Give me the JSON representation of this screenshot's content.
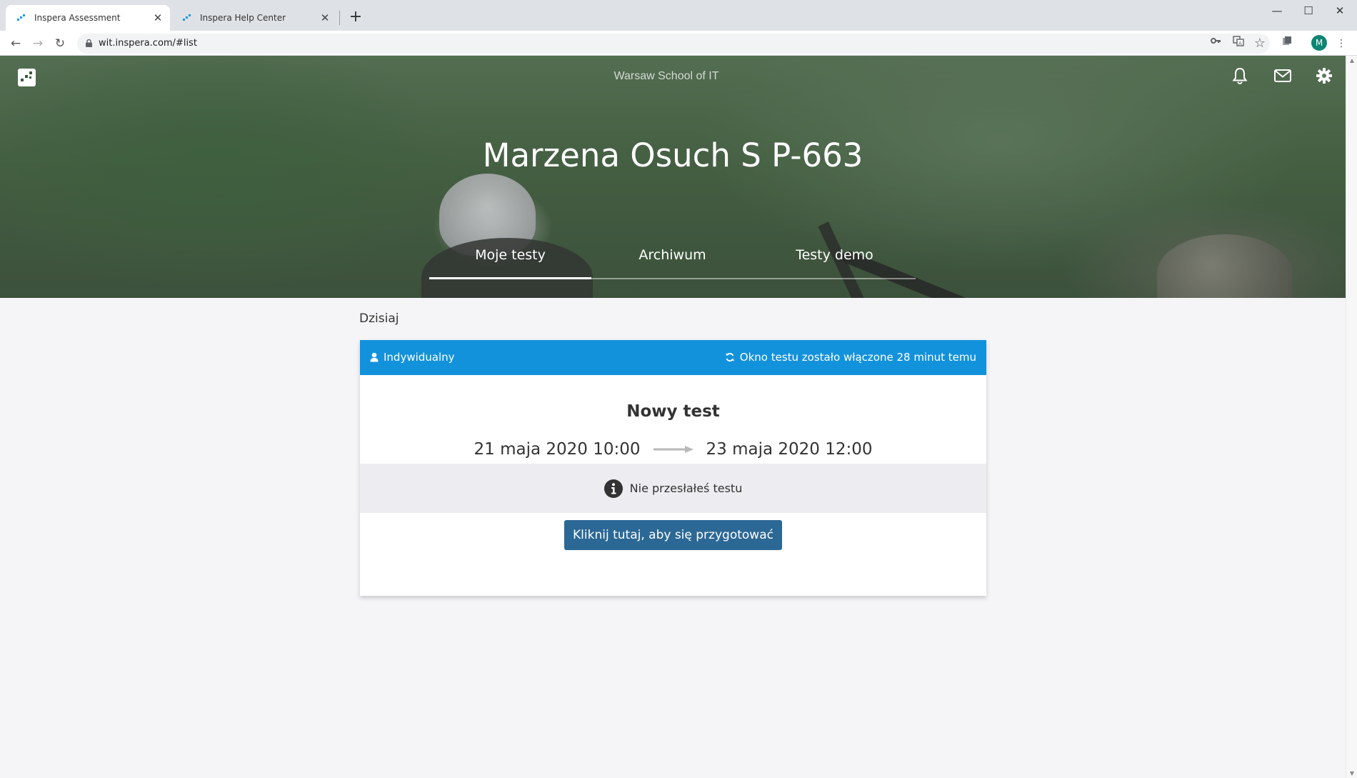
{
  "browser": {
    "tabs": [
      {
        "title": "Inspera Assessment",
        "active": true
      },
      {
        "title": "Inspera Help Center",
        "active": false
      }
    ],
    "url": "wit.inspera.com/#list",
    "profile_initial": "M"
  },
  "header": {
    "school": "Warsaw School of IT",
    "student_name": "Marzena Osuch S P-663",
    "tabs": [
      "Moje testy",
      "Archiwum",
      "Testy demo"
    ],
    "active_tab": "Moje testy"
  },
  "main": {
    "section_label": "Dzisiaj",
    "card": {
      "type_label": "Indywidualny",
      "window_status": "Okno testu zostało włączone 28 minut temu",
      "title": "Nowy test",
      "start": "21 maja 2020 10:00",
      "end": "23 maja 2020 12:00",
      "status": "Nie przesłałeś testu",
      "action_label": "Kliknij tutaj, aby się przygotować"
    }
  },
  "colors": {
    "card_header": "#1392dc",
    "action_button": "#2c6895",
    "status_background": "#ececf1"
  },
  "icons": [
    "inspera-logo-icon",
    "bell-icon",
    "mail-icon",
    "gear-icon",
    "user-icon",
    "refresh-icon",
    "arrow-right-icon",
    "info-icon"
  ]
}
